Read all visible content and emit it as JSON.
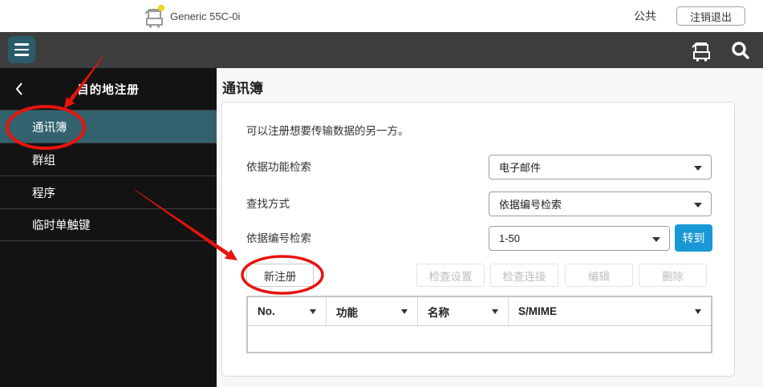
{
  "topbar": {
    "device_name": "Generic 55C-0i",
    "scope_label": "公共",
    "logout_label": "注销退出"
  },
  "sidebar": {
    "title": "目的地注册",
    "items": [
      {
        "label": "通讯簿",
        "active": true
      },
      {
        "label": "群组",
        "active": false
      },
      {
        "label": "程序",
        "active": false
      },
      {
        "label": "临时单触键",
        "active": false
      }
    ]
  },
  "main": {
    "page_title": "通讯簿",
    "description": "可以注册想要传输数据的另一方。",
    "form": {
      "rows": [
        {
          "label": "依据功能检索",
          "value": "电子邮件"
        },
        {
          "label": "查找方式",
          "value": "依据编号检索"
        },
        {
          "label": "依据编号检索",
          "value": "1-50"
        }
      ],
      "go_label": "转到"
    },
    "actions": {
      "new_label": "新注册",
      "disabled": [
        "检查设置",
        "检查连接",
        "编辑",
        "删除"
      ]
    },
    "table": {
      "columns": [
        "No.",
        "功能",
        "名称",
        "S/MIME"
      ]
    }
  },
  "icons": {
    "menu": "hamburger-menu",
    "device_status": "printer-device",
    "search": "magnifier",
    "back": "chevron-left",
    "sort": "caret-down"
  },
  "colors": {
    "accent-teal": "#2a5b69",
    "active-item": "#33626e",
    "primary-blue": "#1898d6",
    "annotation-red": "#e8130d",
    "appbar-dark": "#3d3d3d",
    "sidebar-black": "#131313"
  }
}
